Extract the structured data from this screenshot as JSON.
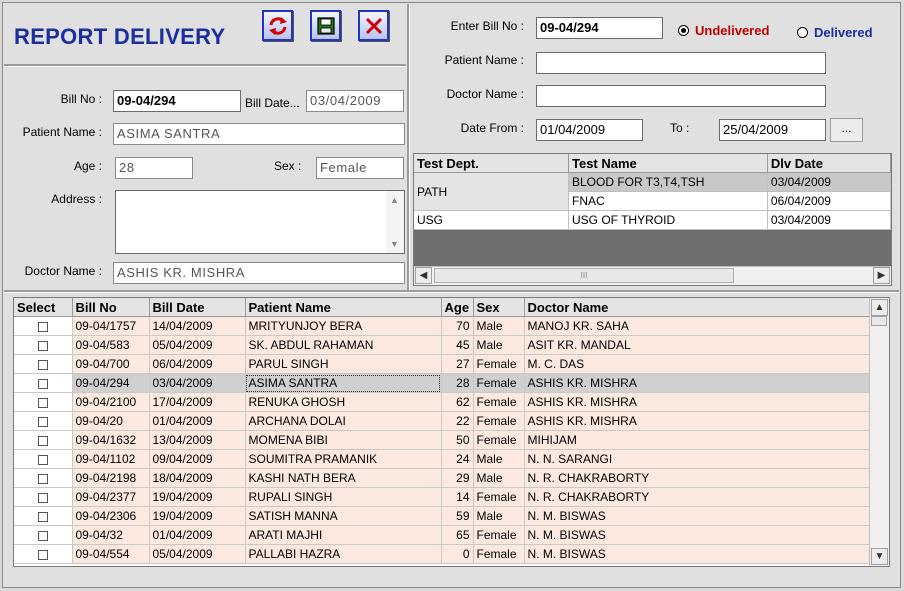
{
  "header": {
    "title": "REPORT DELIVERY",
    "buttons": [
      {
        "name": "refresh-button",
        "icon": "refresh-icon"
      },
      {
        "name": "save-button",
        "icon": "save-icon"
      },
      {
        "name": "close-button",
        "icon": "close-icon"
      }
    ]
  },
  "bill": {
    "bill_no_label": "Bill No :",
    "bill_no": "09-04/294",
    "bill_date_label": "Bill Date...",
    "bill_date": "03/04/2009",
    "patient_name_label": "Patient Name :",
    "patient_name": "ASIMA  SANTRA",
    "age_label": "Age :",
    "age": "28",
    "sex_label": "Sex :",
    "sex": "Female",
    "address_label": "Address :",
    "address": "",
    "doctor_name_label": "Doctor Name :",
    "doctor_name": "ASHIS KR. MISHRA"
  },
  "search": {
    "enter_bill_label": "Enter Bill No :",
    "enter_bill": "09-04/294",
    "undelivered_label": "Undelivered",
    "delivered_label": "Delivered",
    "selected_status": "Undelivered",
    "patient_name_label": "Patient Name :",
    "patient_name": "",
    "doctor_name_label": "Doctor Name :",
    "doctor_name": "",
    "date_from_label": "Date From :",
    "date_from": "01/04/2009",
    "to_label": "To :",
    "date_to": "25/04/2009",
    "browse_label": "...",
    "undelivered_color": "#c00000",
    "delivered_color": "#1a2ea0"
  },
  "tests": {
    "columns": [
      "Test Dept.",
      "Test Name",
      "Dlv Date"
    ],
    "rows": [
      {
        "dept": "PATH",
        "name": "BLOOD FOR T3,T4,TSH",
        "date": "03/04/2009"
      },
      {
        "dept": "",
        "name": "FNAC",
        "date": "06/04/2009"
      },
      {
        "dept": "USG",
        "name": "USG OF THYROID",
        "date": "03/04/2009"
      }
    ],
    "scroll_glyph": "III"
  },
  "patients": {
    "columns": [
      "Select",
      "Bill No",
      "Bill Date",
      "Patient Name",
      "Age",
      "Sex",
      "Doctor Name"
    ],
    "selected_index": 3,
    "rows": [
      [
        "09-04/1757",
        "14/04/2009",
        "MRITYUNJOY  BERA",
        "70",
        "Male",
        "MANOJ KR. SAHA"
      ],
      [
        "09-04/583",
        "05/04/2009",
        "SK. ABDUL  RAHAMAN",
        "45",
        "Male",
        "ASIT KR. MANDAL"
      ],
      [
        "09-04/700",
        "06/04/2009",
        "PARUL SINGH",
        "27",
        "Female",
        "M. C. DAS"
      ],
      [
        "09-04/294",
        "03/04/2009",
        "ASIMA  SANTRA",
        "28",
        "Female",
        "ASHIS KR. MISHRA"
      ],
      [
        "09-04/2100",
        "17/04/2009",
        "RENUKA  GHOSH",
        "62",
        "Female",
        "ASHIS KR. MISHRA"
      ],
      [
        "09-04/20",
        "01/04/2009",
        "ARCHANA DOLAI",
        "22",
        "Female",
        "ASHIS KR. MISHRA"
      ],
      [
        "09-04/1632",
        "13/04/2009",
        "MOMENA  BIBI",
        "50",
        "Female",
        "MIHIJAM"
      ],
      [
        "09-04/1102",
        "09/04/2009",
        "SOUMITRA PRAMANIK",
        "24",
        "Male",
        "N. N. SARANGI"
      ],
      [
        "09-04/2198",
        "18/04/2009",
        "KASHI NATH  BERA",
        "29",
        "Male",
        "N. R. CHAKRABORTY"
      ],
      [
        "09-04/2377",
        "19/04/2009",
        "RUPALI  SINGH",
        "14",
        "Female",
        "N. R. CHAKRABORTY"
      ],
      [
        "09-04/2306",
        "19/04/2009",
        "SATISH  MANNA",
        "59",
        "Male",
        "N. M. BISWAS"
      ],
      [
        "09-04/32",
        "01/04/2009",
        "ARATI  MAJHI",
        "65",
        "Female",
        "N. M. BISWAS"
      ],
      [
        "09-04/554",
        "05/04/2009",
        "PALLABI  HAZRA",
        "0",
        "Female",
        "N. M. BISWAS"
      ]
    ]
  }
}
